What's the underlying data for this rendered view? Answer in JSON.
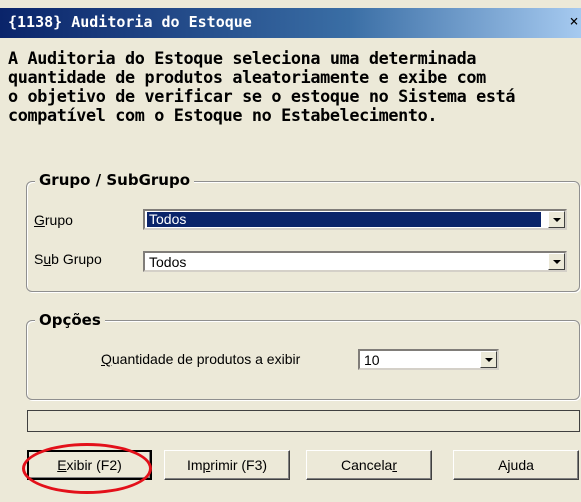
{
  "window": {
    "title": "{1138} Auditoria do Estoque",
    "close_glyph": "×"
  },
  "description_lines": [
    "A Auditoria do Estoque seleciona uma determinada",
    "quantidade de produtos aleatoriamente e exibe com",
    "o objetivo de verificar se o estoque no Sistema está",
    "compatível com o Estoque no Estabelecimento."
  ],
  "grupo_box": {
    "legend": "Grupo / SubGrupo",
    "grupo": {
      "label_accel": "G",
      "label_rest": "rupo",
      "value": "Todos"
    },
    "subgrupo": {
      "label_pre": "S",
      "label_accel": "u",
      "label_rest": "b Grupo",
      "value": "Todos"
    }
  },
  "opcoes_box": {
    "legend": "Opções",
    "quantidade": {
      "label_accel": "Q",
      "label_rest": "uantidade de produtos a exibir",
      "value": "10"
    }
  },
  "buttons": {
    "exibir": {
      "accel": "E",
      "rest": "xibir (F2)"
    },
    "imprimir": {
      "pre": "Im",
      "accel": "p",
      "rest": "rimir (F3)"
    },
    "cancelar": {
      "pre": "Cancela",
      "accel": "r",
      "rest": ""
    },
    "ajuda": {
      "pre": "Ajuda"
    }
  },
  "colors": {
    "titlebar": "#0a246a",
    "dialog_bg": "#ece9d8",
    "selection": "#0a246a",
    "annotation": "#e3101a"
  },
  "icons": [
    "close-icon",
    "dropdown-arrow-icon"
  ]
}
